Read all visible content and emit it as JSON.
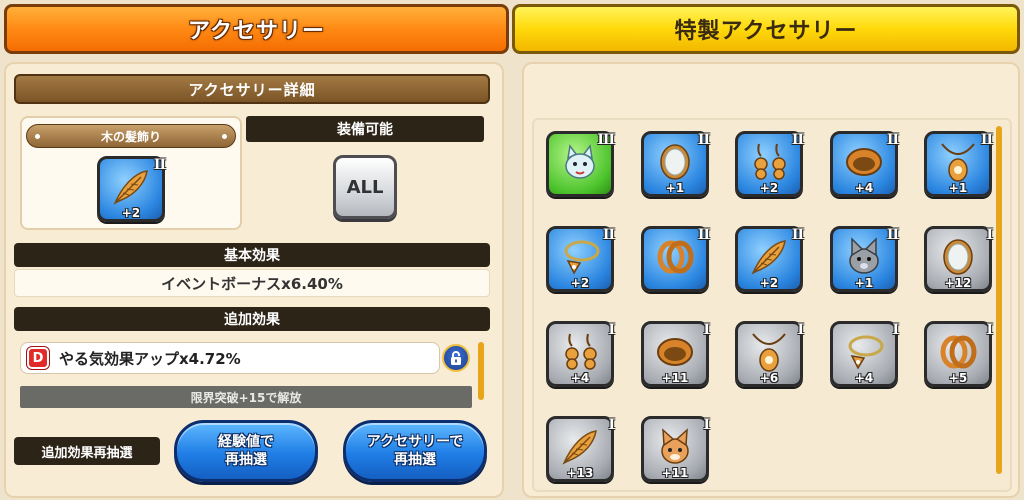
{
  "tabs": {
    "accessory": "アクセサリー",
    "special_accessory": "特製アクセサリー"
  },
  "detail": {
    "header": "アクセサリー詳細",
    "item_name": "木の髪飾り",
    "item_rank": "II",
    "item_plus": "+2",
    "item_icon": "leaf-icon",
    "equip_label": "装備可能",
    "equip_value": "ALL"
  },
  "basic_effect": {
    "label": "基本効果",
    "value": "イベントボーナスx6.40%"
  },
  "extra_effect": {
    "label": "追加効果",
    "grade": "D",
    "value": "やる気効果アップx4.72%",
    "limit_text": "限界突破+15で解放"
  },
  "reroll": {
    "label": "追加効果再抽選",
    "exp_button_line1": "経験値で",
    "exp_button_line2": "再抽選",
    "acc_button_line1": "アクセサリーで",
    "acc_button_line2": "再抽選"
  },
  "colors": {
    "tab_active": "#ff8a14",
    "tab_inactive": "#ffd90a",
    "rank_blue": "#2b86e0",
    "rank_grey": "#a9adb3",
    "rank_green": "#4cc42c",
    "grade_d": "#e12a2a"
  },
  "accessories": [
    {
      "icon": "cat-icon",
      "rank": "III",
      "plus": "",
      "color": "green"
    },
    {
      "icon": "mirror-icon",
      "rank": "II",
      "plus": "+1",
      "color": "blue"
    },
    {
      "icon": "earrings-icon",
      "rank": "II",
      "plus": "+2",
      "color": "blue"
    },
    {
      "icon": "bracelet-icon",
      "rank": "II",
      "plus": "+4",
      "color": "blue"
    },
    {
      "icon": "pendant-icon",
      "rank": "II",
      "plus": "+1",
      "color": "blue"
    },
    {
      "icon": "necklace-icon",
      "rank": "II",
      "plus": "+2",
      "color": "blue"
    },
    {
      "icon": "rings-icon",
      "rank": "II",
      "plus": "",
      "color": "blue"
    },
    {
      "icon": "leaf-icon",
      "rank": "II",
      "plus": "+2",
      "color": "blue"
    },
    {
      "icon": "wolf-icon",
      "rank": "II",
      "plus": "+1",
      "color": "blue"
    },
    {
      "icon": "mirror-icon",
      "rank": "I",
      "plus": "+12",
      "color": "grey"
    },
    {
      "icon": "earrings-icon",
      "rank": "I",
      "plus": "+4",
      "color": "grey"
    },
    {
      "icon": "bracelet-icon",
      "rank": "I",
      "plus": "+11",
      "color": "grey"
    },
    {
      "icon": "pendant-icon",
      "rank": "I",
      "plus": "+6",
      "color": "grey"
    },
    {
      "icon": "necklace-icon",
      "rank": "I",
      "plus": "+4",
      "color": "grey"
    },
    {
      "icon": "rings-icon",
      "rank": "I",
      "plus": "+5",
      "color": "grey"
    },
    {
      "icon": "leaf-icon",
      "rank": "I",
      "plus": "+13",
      "color": "grey"
    },
    {
      "icon": "fox-icon",
      "rank": "I",
      "plus": "+11",
      "color": "grey"
    }
  ]
}
